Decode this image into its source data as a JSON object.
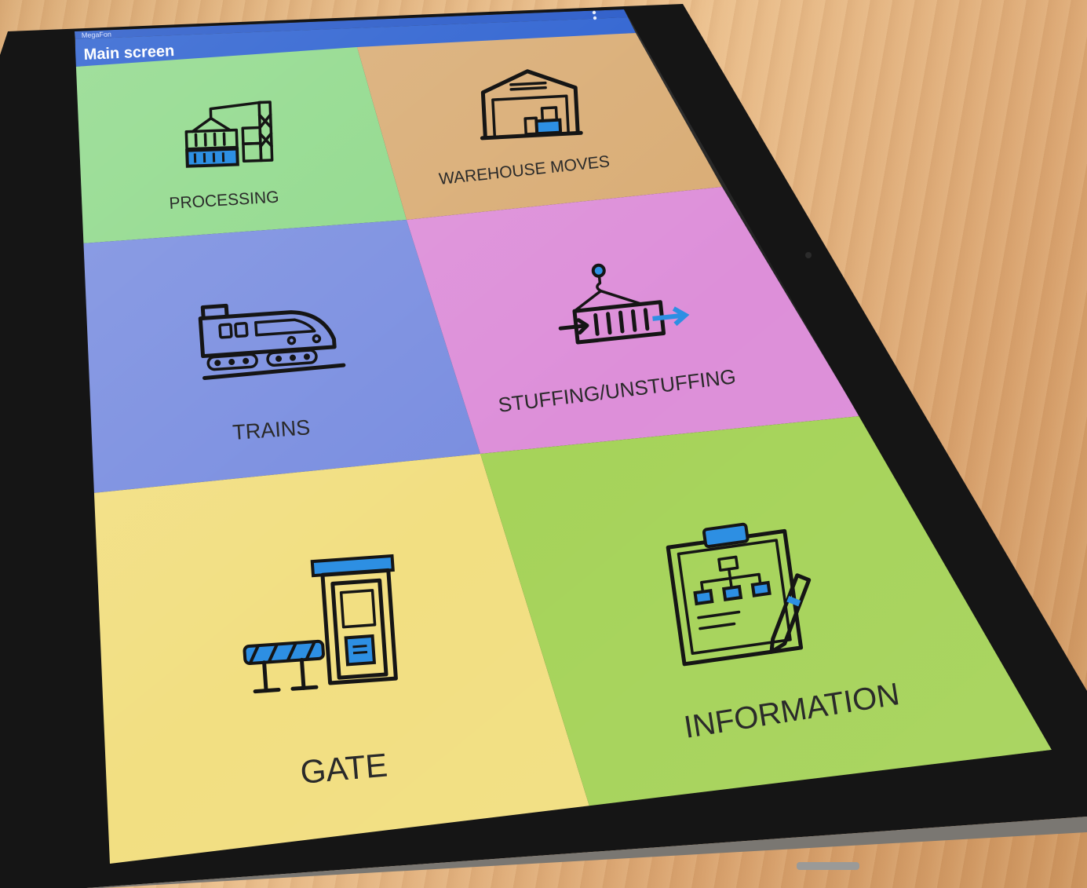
{
  "status_bar": {
    "carrier": "MegaFon"
  },
  "app_bar": {
    "title": "Main screen"
  },
  "tiles": [
    {
      "label": "PROCESSING",
      "icon": "container-crane-icon",
      "color": "#8fd98a"
    },
    {
      "label": "WAREHOUSE MOVES",
      "icon": "warehouse-icon",
      "color": "#d9ac74"
    },
    {
      "label": "TRAINS",
      "icon": "train-icon",
      "color": "#7a8ee0"
    },
    {
      "label": "STUFFING/UNSTUFFING",
      "icon": "container-hook-icon",
      "color": "#dd8fd9"
    },
    {
      "label": "GATE",
      "icon": "gate-booth-icon",
      "color": "#f2df82"
    },
    {
      "label": "INFORMATION",
      "icon": "clipboard-icon",
      "color": "#a6d35a"
    }
  ],
  "colors": {
    "app_bar": "#2a5fd0",
    "status_bar": "#2456c7",
    "accent_icon": "#2d8fe3"
  }
}
